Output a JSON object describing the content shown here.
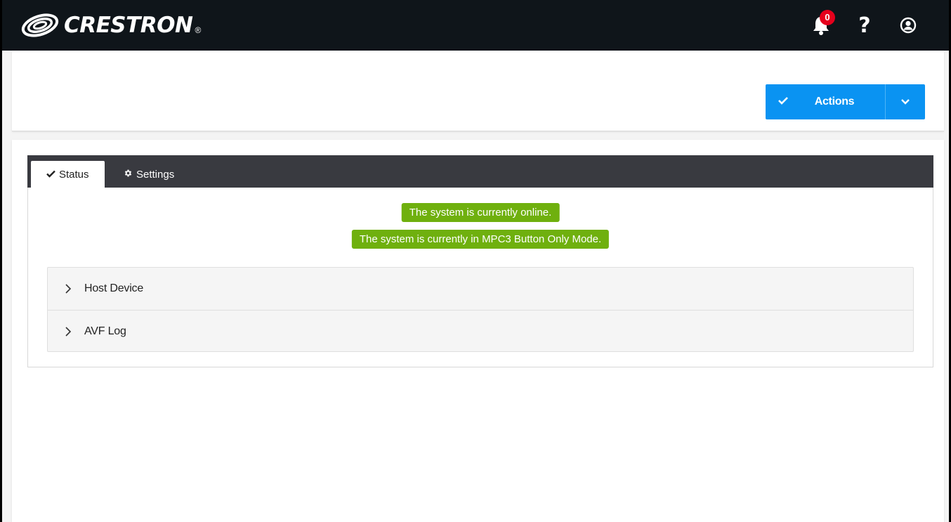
{
  "header": {
    "brand": "CRESTRON",
    "registered_mark": "®",
    "notification_count": "0",
    "help_glyph": "?"
  },
  "toolbar": {
    "actions_label": "Actions"
  },
  "tabs": [
    {
      "label": "Status",
      "icon": "check-icon",
      "active": true
    },
    {
      "label": "Settings",
      "icon": "gear-icon",
      "active": false
    }
  ],
  "status_messages": [
    "The system is currently online.",
    "The system is currently in MPC3 Button Only Mode."
  ],
  "accordion": [
    {
      "label": "Host Device"
    },
    {
      "label": "AVF Log"
    }
  ],
  "colors": {
    "topbar": "#0f151a",
    "accent": "#0a93f2",
    "status_ok": "#6fb00e",
    "badge": "#e5001c",
    "tabbar": "#393a40"
  }
}
